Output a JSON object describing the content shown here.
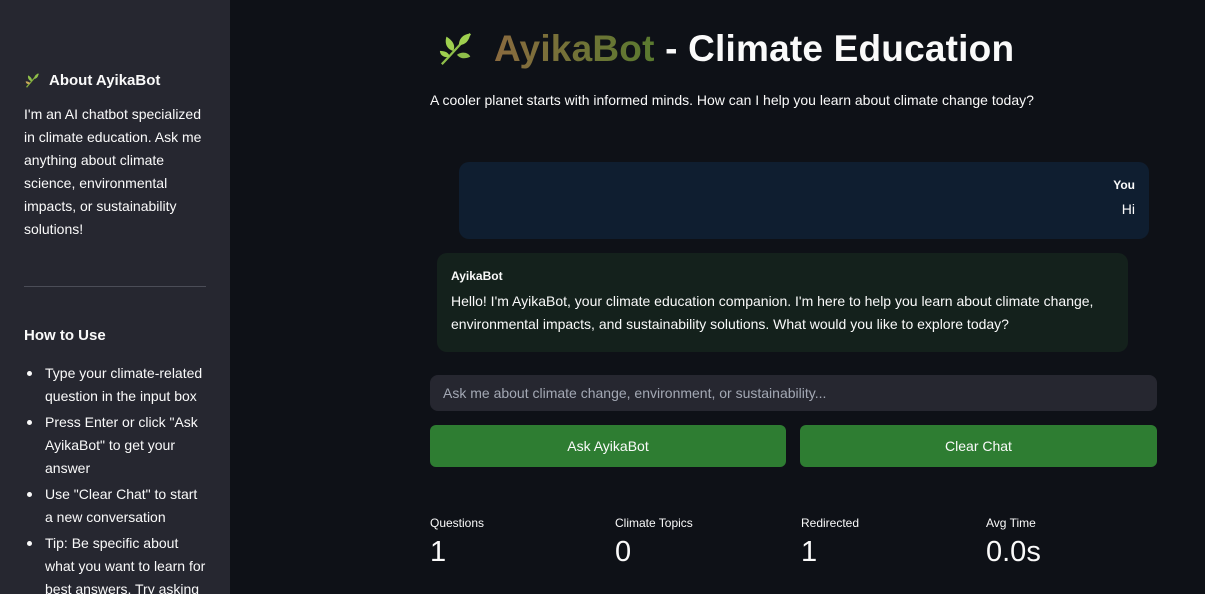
{
  "sidebar": {
    "about_title": "About AyikaBot",
    "about_icon": "leaf-icon",
    "about_text": "I'm an AI chatbot specialized in climate education. Ask me anything about climate science, environmental impacts, or sustainability solutions!",
    "howto_title": "How to Use",
    "howto_items": [
      {
        "text": "Type your climate-related question in the input box"
      },
      {
        "text": "Press Enter or click \"Ask AyikaBot\" to get your answer"
      },
      {
        "text": "Use \"Clear Chat\" to start a new conversation"
      },
      {
        "text": "Tip: Be specific about what you want to learn for best answers. Try asking"
      }
    ]
  },
  "header": {
    "title_part1": "AyikaBot",
    "title_part2": " - Climate Education",
    "subtitle": "A cooler planet starts with informed minds. How can I help you learn about climate change today?"
  },
  "chat": {
    "messages": [
      {
        "sender": "You",
        "text": "Hi"
      },
      {
        "sender": "AyikaBot",
        "text": "Hello! I'm AyikaBot, your climate education companion. I'm here to help you learn about climate change, environmental impacts, and sustainability solutions. What would you like to explore today?"
      }
    ],
    "input_placeholder": "Ask me about climate change, environment, or sustainability...",
    "input_value": ""
  },
  "buttons": {
    "ask": "Ask AyikaBot",
    "clear": "Clear Chat"
  },
  "metrics": [
    {
      "label": "Questions",
      "value": "1"
    },
    {
      "label": "Climate Topics",
      "value": "0"
    },
    {
      "label": "Redirected",
      "value": "1"
    },
    {
      "label": "Avg Time",
      "value": "0.0s"
    }
  ],
  "colors": {
    "background": "#0e1117",
    "sidebar": "#262730",
    "user_bubble": "#0f1e30",
    "bot_bubble": "#14211c",
    "button": "#2e7d32"
  }
}
